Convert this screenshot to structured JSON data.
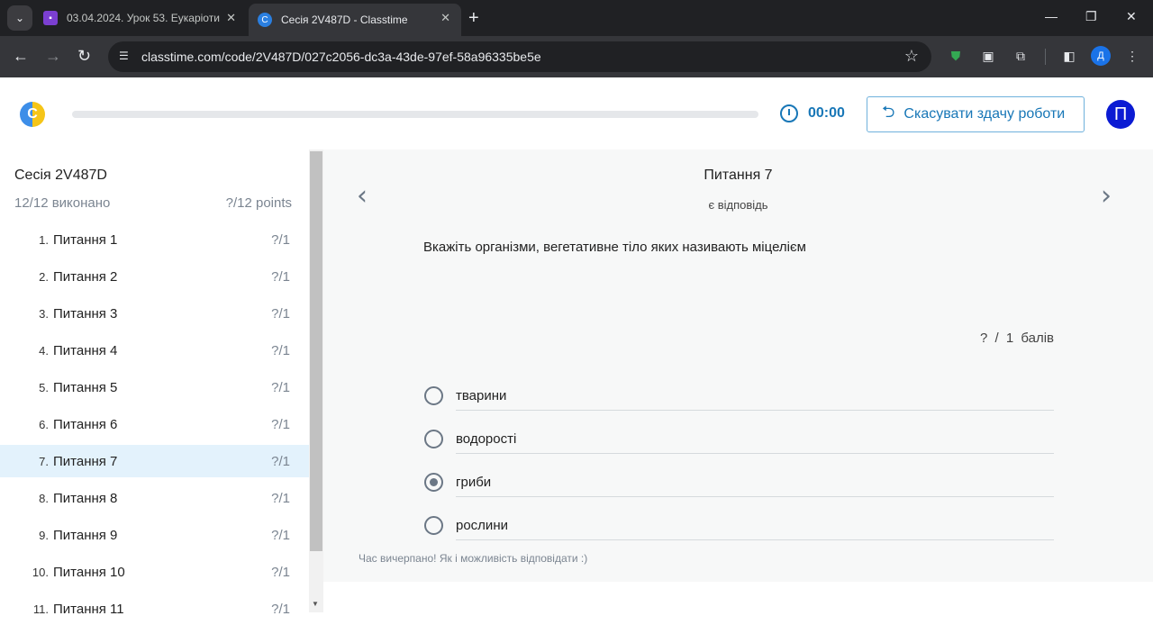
{
  "browser": {
    "tabs": [
      {
        "title": "03.04.2024. Урок 53. Еукаріоти"
      },
      {
        "title": "Сесія 2V487D - Classtime"
      }
    ],
    "url": "classtime.com/code/2V487D/027c2056-dc3a-43de-97ef-58a96335be5e",
    "profile_initial": "Д"
  },
  "header": {
    "timer": "00:00",
    "cancel_label": "Скасувати здачу роботи",
    "avatar_initial": "П"
  },
  "sidebar": {
    "session_title": "Сесія 2V487D",
    "done": "12/12 виконано",
    "points": "?/12 points",
    "items": [
      {
        "num": "1.",
        "label": "Питання 1",
        "points": "?/1"
      },
      {
        "num": "2.",
        "label": "Питання 2",
        "points": "?/1"
      },
      {
        "num": "3.",
        "label": "Питання 3",
        "points": "?/1"
      },
      {
        "num": "4.",
        "label": "Питання 4",
        "points": "?/1"
      },
      {
        "num": "5.",
        "label": "Питання 5",
        "points": "?/1"
      },
      {
        "num": "6.",
        "label": "Питання 6",
        "points": "?/1"
      },
      {
        "num": "7.",
        "label": "Питання 7",
        "points": "?/1"
      },
      {
        "num": "8.",
        "label": "Питання 8",
        "points": "?/1"
      },
      {
        "num": "9.",
        "label": "Питання 9",
        "points": "?/1"
      },
      {
        "num": "10.",
        "label": "Питання 10",
        "points": "?/1"
      },
      {
        "num": "11.",
        "label": "Питання 11",
        "points": "?/1"
      }
    ]
  },
  "question": {
    "title": "Питання 7",
    "status": "є відповідь",
    "text": "Вкажіть організми, вегетативне тіло яких називають міцелієм",
    "score": "? / 1 балів",
    "options": [
      {
        "label": "тварини",
        "selected": false
      },
      {
        "label": "водорості",
        "selected": false
      },
      {
        "label": "гриби",
        "selected": true
      },
      {
        "label": "рослини",
        "selected": false
      }
    ],
    "timeout_note": "Час вичерпано! Як і можливість відповідати :)"
  },
  "colors": {
    "accent": "#1877b7",
    "avatar_bg": "#0b1bd3",
    "active_row": "#e3f2fc"
  }
}
